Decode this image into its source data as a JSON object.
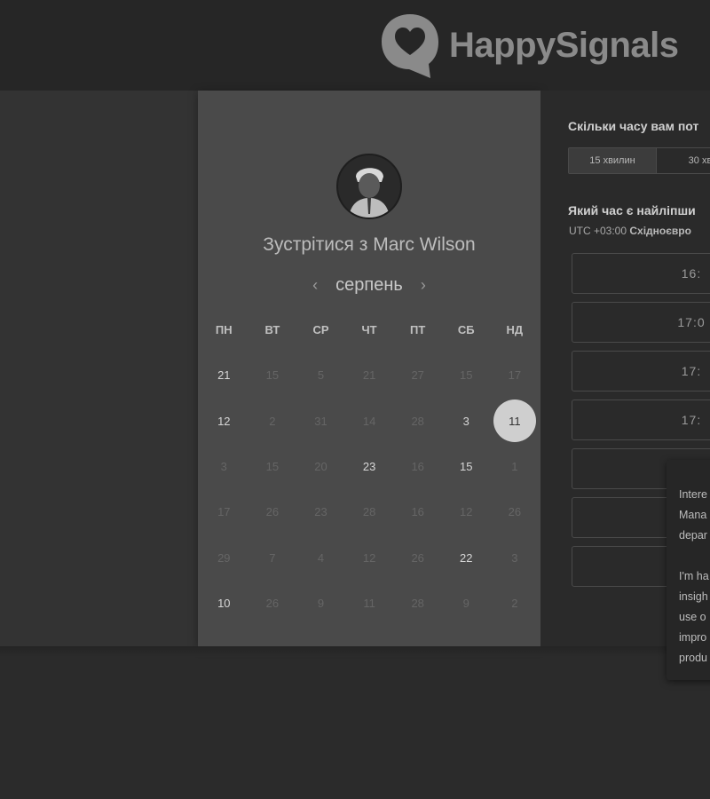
{
  "header": {
    "brand": "HappySignals",
    "logo_icon": "heart-speech-bubble-icon"
  },
  "calendar": {
    "meet_prefix": "Зустрітися з ",
    "host_name": "Marc Wilson",
    "avatar_icon": "user-avatar",
    "prev_icon": "‹",
    "next_icon": "›",
    "month": "серпень",
    "weekdays": [
      "ПН",
      "ВТ",
      "СР",
      "ЧТ",
      "ПТ",
      "СБ",
      "НД"
    ],
    "days": [
      {
        "label": "21",
        "state": "active"
      },
      {
        "label": "15",
        "state": "disabled"
      },
      {
        "label": "5",
        "state": "disabled"
      },
      {
        "label": "21",
        "state": "disabled"
      },
      {
        "label": "27",
        "state": "disabled"
      },
      {
        "label": "15",
        "state": "disabled"
      },
      {
        "label": "17",
        "state": "disabled"
      },
      {
        "label": "12",
        "state": "active"
      },
      {
        "label": "2",
        "state": "disabled"
      },
      {
        "label": "31",
        "state": "disabled"
      },
      {
        "label": "14",
        "state": "disabled"
      },
      {
        "label": "28",
        "state": "disabled"
      },
      {
        "label": "3",
        "state": "active"
      },
      {
        "label": "11",
        "state": "selected"
      },
      {
        "label": "3",
        "state": "disabled"
      },
      {
        "label": "15",
        "state": "disabled"
      },
      {
        "label": "20",
        "state": "disabled"
      },
      {
        "label": "23",
        "state": "active"
      },
      {
        "label": "16",
        "state": "disabled"
      },
      {
        "label": "15",
        "state": "active"
      },
      {
        "label": "1",
        "state": "disabled"
      },
      {
        "label": "17",
        "state": "disabled"
      },
      {
        "label": "26",
        "state": "disabled"
      },
      {
        "label": "23",
        "state": "disabled"
      },
      {
        "label": "28",
        "state": "disabled"
      },
      {
        "label": "16",
        "state": "disabled"
      },
      {
        "label": "12",
        "state": "disabled"
      },
      {
        "label": "26",
        "state": "disabled"
      },
      {
        "label": "29",
        "state": "disabled"
      },
      {
        "label": "7",
        "state": "disabled"
      },
      {
        "label": "4",
        "state": "disabled"
      },
      {
        "label": "12",
        "state": "disabled"
      },
      {
        "label": "26",
        "state": "disabled"
      },
      {
        "label": "22",
        "state": "active"
      },
      {
        "label": "3",
        "state": "disabled"
      },
      {
        "label": "10",
        "state": "active"
      },
      {
        "label": "26",
        "state": "disabled"
      },
      {
        "label": "9",
        "state": "disabled"
      },
      {
        "label": "11",
        "state": "disabled"
      },
      {
        "label": "28",
        "state": "disabled"
      },
      {
        "label": "9",
        "state": "disabled"
      },
      {
        "label": "2",
        "state": "disabled"
      }
    ]
  },
  "booking": {
    "duration_question": "Скільки часу вам пот",
    "durations": [
      {
        "label": "15 хвилин",
        "selected": true
      },
      {
        "label": "30 хв",
        "selected": false
      }
    ],
    "time_question": "Який час є найліпши",
    "tz_offset": "UTC +03:00 ",
    "tz_name": "Східноєвро",
    "slots": [
      "16:",
      "17:0",
      "17:",
      "17:",
      "",
      "",
      ""
    ]
  },
  "popup": {
    "lines": [
      "Intere",
      "Mana",
      "depar",
      "",
      "I'm ha",
      "insigh",
      "use o",
      "impro",
      "produ"
    ]
  }
}
